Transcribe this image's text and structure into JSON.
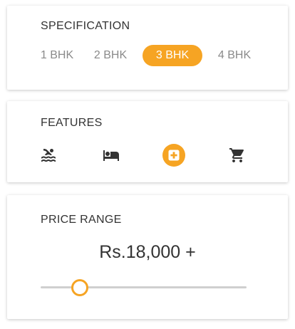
{
  "specification": {
    "title": "SPECIFICATION",
    "options": [
      "1 BHK",
      "2 BHK",
      "3 BHK",
      "4 BHK"
    ],
    "selected": "3 BHK"
  },
  "features": {
    "title": "FEATURES",
    "items": [
      {
        "icon": "pool-icon"
      },
      {
        "icon": "bed-icon"
      },
      {
        "icon": "medical-cross-icon",
        "selected": true
      },
      {
        "icon": "shopping-cart-icon"
      }
    ]
  },
  "price_range": {
    "title": "PRICE RANGE",
    "value_label": "Rs.18,000 +",
    "slider_fraction": 0.19
  },
  "colors": {
    "accent": "#f6a423",
    "track": "#cfcfcf",
    "text": "#333333",
    "muted": "#8a8a8a"
  }
}
